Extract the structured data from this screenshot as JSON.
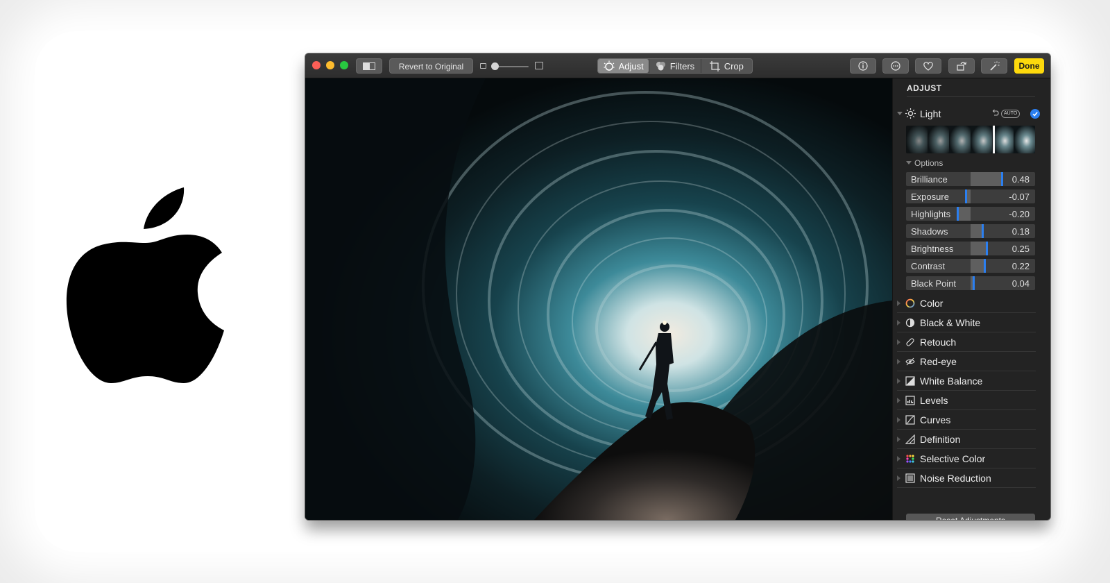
{
  "toolbar": {
    "revert_label": "Revert to Original",
    "tabs": [
      {
        "label": "Adjust",
        "icon": "adjust-dial-icon",
        "active": true
      },
      {
        "label": "Filters",
        "icon": "filters-circles-icon",
        "active": false
      },
      {
        "label": "Crop",
        "icon": "crop-icon",
        "active": false
      }
    ],
    "done_label": "Done",
    "done_color": "#fdd90c"
  },
  "panel": {
    "title": "ADJUST",
    "light": {
      "label": "Light",
      "auto_label": "AUTO",
      "enabled": true,
      "options_label": "Options",
      "sliders": [
        {
          "name": "Brilliance",
          "value": "0.48",
          "level": 0.48
        },
        {
          "name": "Exposure",
          "value": "-0.07",
          "level": -0.07
        },
        {
          "name": "Highlights",
          "value": "-0.20",
          "level": -0.2
        },
        {
          "name": "Shadows",
          "value": "0.18",
          "level": 0.18
        },
        {
          "name": "Brightness",
          "value": "0.25",
          "level": 0.25
        },
        {
          "name": "Contrast",
          "value": "0.22",
          "level": 0.22
        },
        {
          "name": "Black Point",
          "value": "0.04",
          "level": 0.04
        }
      ]
    },
    "sections": [
      {
        "label": "Color",
        "icon": "color-circle-icon"
      },
      {
        "label": "Black & White",
        "icon": "half-circle-icon"
      },
      {
        "label": "Retouch",
        "icon": "bandage-icon"
      },
      {
        "label": "Red-eye",
        "icon": "eye-icon"
      },
      {
        "label": "White Balance",
        "icon": "white-balance-icon"
      },
      {
        "label": "Levels",
        "icon": "levels-icon"
      },
      {
        "label": "Curves",
        "icon": "curves-icon"
      },
      {
        "label": "Definition",
        "icon": "definition-icon"
      },
      {
        "label": "Selective Color",
        "icon": "selective-color-icon"
      },
      {
        "label": "Noise Reduction",
        "icon": "noise-reduction-icon"
      }
    ],
    "reset_label": "Reset Adjustments"
  },
  "colors": {
    "accent": "#2b7ff0",
    "done": "#fdd90c"
  }
}
